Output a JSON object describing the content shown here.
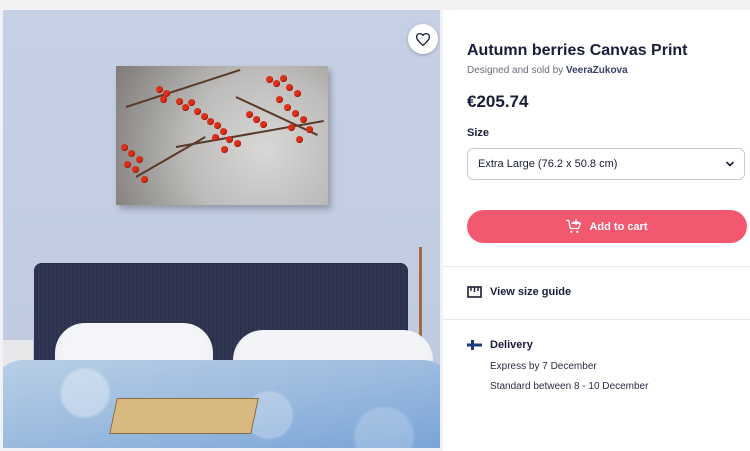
{
  "product": {
    "title": "Autumn berries Canvas Print",
    "byline_prefix": "Designed and sold by",
    "artist": "VeeraZukova",
    "price": "€205.74"
  },
  "size": {
    "label": "Size",
    "selected": "Extra Large (76.2 x 50.8 cm)"
  },
  "cart": {
    "label": "Add to cart"
  },
  "size_guide": {
    "label": "View size guide"
  },
  "delivery": {
    "title": "Delivery",
    "express": "Express by 7 December",
    "standard": "Standard between 8 - 10 December"
  },
  "colors": {
    "accent": "#f25970",
    "heading": "#191d3a",
    "flag_blue": "#1a3a7a"
  },
  "icons": {
    "favorite": "heart-icon",
    "dropdown": "chevron-down-icon",
    "cart": "cart-plus-icon",
    "ruler": "ruler-icon",
    "flag": "finland-flag-icon"
  }
}
